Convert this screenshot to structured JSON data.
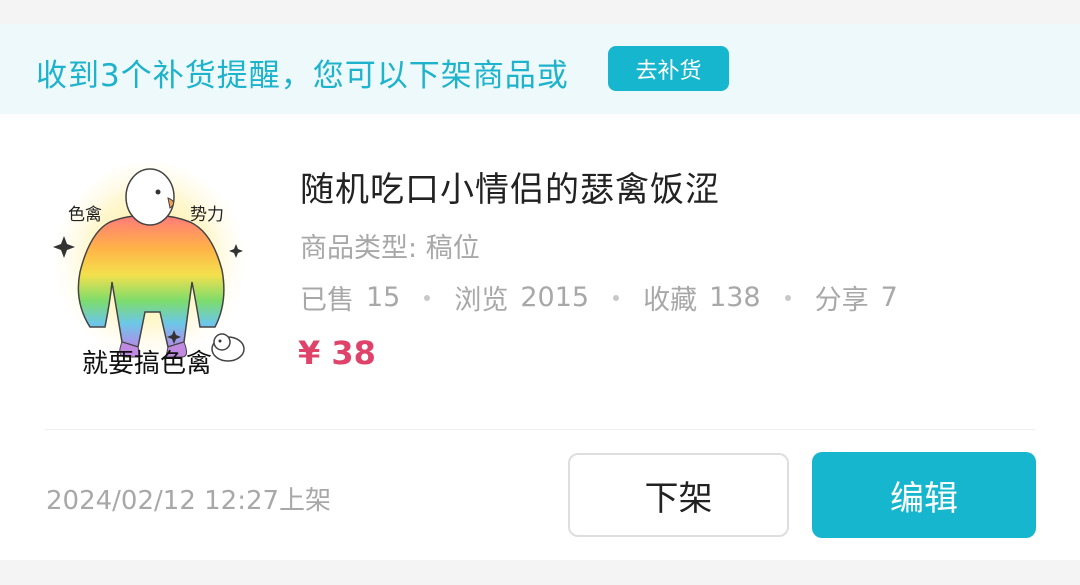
{
  "notice": {
    "text": "收到3个补货提醒，您可以下架商品或",
    "restock_label": "去补货"
  },
  "product": {
    "image_caption": "就要搞色禽",
    "image_text_left": "色禽",
    "image_text_right": "势力",
    "title": "随机吃口小情侣的瑟禽饭涩",
    "type_label": "商品类型:",
    "type_value": "稿位",
    "stats": {
      "sold_label": "已售",
      "sold": "15",
      "views_label": "浏览",
      "views": "2015",
      "fav_label": "收藏",
      "fav": "138",
      "share_label": "分享",
      "share": "7"
    },
    "price": "¥ 38"
  },
  "footer": {
    "listed_time": "2024/02/12 12:27上架",
    "delist_label": "下架",
    "edit_label": "编辑"
  },
  "colors": {
    "accent": "#17b6cf",
    "price": "#e0436a",
    "muted": "#a8a8a8"
  }
}
